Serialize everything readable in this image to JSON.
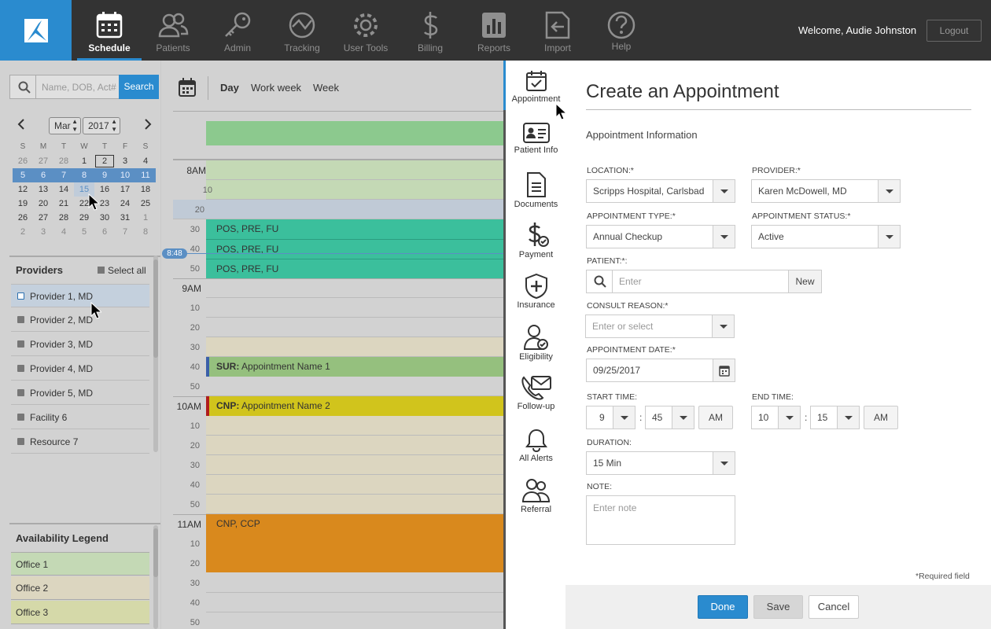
{
  "app": {
    "welcome": "Welcome, Audie Johnston",
    "logout": "Logout"
  },
  "nav": [
    {
      "label": "Schedule",
      "icon": "calendar-icon"
    },
    {
      "label": "Patients",
      "icon": "users-icon"
    },
    {
      "label": "Admin",
      "icon": "key-icon"
    },
    {
      "label": "Tracking",
      "icon": "tracking-icon"
    },
    {
      "label": "User Tools",
      "icon": "gear-icon"
    },
    {
      "label": "Billing",
      "icon": "dollar-icon"
    },
    {
      "label": "Reports",
      "icon": "chart-icon"
    },
    {
      "label": "Import",
      "icon": "import-icon"
    },
    {
      "label": "Help",
      "icon": "help-icon"
    }
  ],
  "search": {
    "placeholder": "Name, DOB, Act#",
    "button": "Search"
  },
  "calendar": {
    "month": "Mar",
    "year": "2017",
    "weekdays": [
      "S",
      "M",
      "T",
      "W",
      "T",
      "F",
      "S"
    ],
    "weeks": [
      [
        "26",
        "27",
        "28",
        "1",
        "2",
        "3",
        "4"
      ],
      [
        "5",
        "6",
        "7",
        "8",
        "9",
        "10",
        "11"
      ],
      [
        "12",
        "13",
        "14",
        "15",
        "16",
        "17",
        "18"
      ],
      [
        "19",
        "20",
        "21",
        "22",
        "23",
        "24",
        "25"
      ],
      [
        "26",
        "27",
        "28",
        "29",
        "30",
        "31",
        "1"
      ],
      [
        "2",
        "3",
        "4",
        "5",
        "6",
        "7",
        "8"
      ]
    ]
  },
  "providers": {
    "title": "Providers",
    "select_all": "Select all",
    "items": [
      "Provider 1, MD",
      "Provider 2, MD",
      "Provider 3, MD",
      "Provider 4, MD",
      "Provider 5, MD",
      "Facility 6",
      "Resource 7"
    ]
  },
  "legend": {
    "title": "Availability Legend",
    "items": [
      "Office 1",
      "Office 2",
      "Office 3"
    ]
  },
  "views": [
    "Day",
    "Work week",
    "Week"
  ],
  "times": {
    "t8am": "8AM",
    "t9am": "9AM",
    "t10am": "10AM",
    "t11am": "11AM",
    "m10": "10",
    "m20": "20",
    "m30": "30",
    "m40": "40",
    "m50": "50",
    "now": "8:48"
  },
  "appointments": [
    {
      "text": "POS, PRE, FU"
    },
    {
      "text": "POS, PRE, FU"
    },
    {
      "text": "POS, PRE, FU"
    },
    {
      "prefix": "SUR:",
      "text": " Appointment Name 1"
    },
    {
      "prefix": "CNP:",
      "text": " Appointment Name 2"
    },
    {
      "text": "CNP, CCP"
    }
  ],
  "sidenav": [
    "Appointment",
    "Patient Info",
    "Documents",
    "Payment",
    "Insurance",
    "Eligibility",
    "Follow-up",
    "All Alerts",
    "Referral"
  ],
  "form": {
    "title": "Create an Appointment",
    "section": "Appointment Information",
    "location_label": "LOCATION:*",
    "location": "Scripps Hospital, Carlsbad",
    "provider_label": "PROVIDER:*",
    "provider": "Karen McDowell, MD",
    "type_label": "APPOINTMENT TYPE:*",
    "type": "Annual Checkup",
    "status_label": "APPOINTMENT STATUS:*",
    "status": "Active",
    "patient_label": "PATIENT:*:",
    "patient_placeholder": "Enter",
    "new_button": "New",
    "reason_label": "CONSULT REASON:*",
    "reason_placeholder": "Enter or select",
    "date_label": "APPOINTMENT DATE:*",
    "date": "09/25/2017",
    "start_label": "START TIME:",
    "start_hour": "9",
    "start_min": "45",
    "start_ampm": "AM",
    "end_label": "END TIME:",
    "end_hour": "10",
    "end_min": "15",
    "end_ampm": "AM",
    "colon": ":",
    "duration_label": "DURATION:",
    "duration": "15 Min",
    "note_label": "NOTE:",
    "note_placeholder": "Enter note",
    "required": "*Required field",
    "done": "Done",
    "save": "Save",
    "cancel": "Cancel"
  },
  "colors": {
    "accent": "#2a8bcf",
    "teal": "#3bbf9c",
    "green": "#95c07e",
    "yellow": "#d1c41c",
    "orange": "#d9891d",
    "office1": "#c4d9b5",
    "office2": "#dcd6c0",
    "office3": "#d5d9a9"
  }
}
